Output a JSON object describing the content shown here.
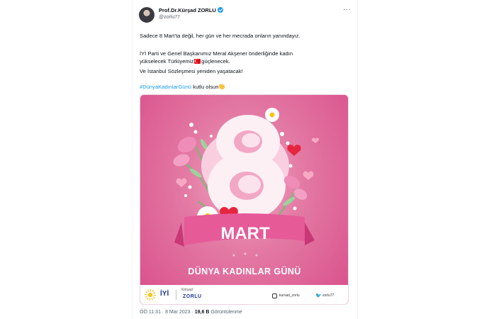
{
  "author": {
    "name": "Prof.Dr.Kürşad ZORLU",
    "handle": "@zorlu77"
  },
  "tweet": {
    "line1": "Sadece 8 Mart’ta değil, her gün ve her mecrada onların yanındayız.",
    "line2": "İYİ Parti ve Genel Başkanımız Meral Akşener önderliğinde kadın",
    "line3_pre": "yükselecek Türkiyemiz",
    "line3_post": "güçlenecek.",
    "line4": "Ve İstanbul Sözleşmesi yeniden yaşatacak!",
    "hashtag": "#DünyaKadınlarGünü",
    "line5_post": " kutlu olsun"
  },
  "media": {
    "number": "8",
    "banner_word": "MART",
    "subtitle": "DÜNYA KADINLAR GÜNÜ",
    "party_logo_text": "İYİ",
    "signature_text": "Kürşad",
    "signature_name": "ZORLU",
    "instagram_handle": "kursad_zorlu",
    "twitter_handle": "zorlu77"
  },
  "meta": {
    "time": "ÖÖ 11:31",
    "separator": "·",
    "date": "8 Mar 2023",
    "views": "19,6 B",
    "views_label": "Görüntülenme"
  },
  "colors": {
    "link": "#1d9bf0",
    "verified": "#1d9bf0",
    "banner_pink": "#e65a98"
  },
  "icons": [
    "verified-badge-icon",
    "more-options-icon",
    "turkey-flag-icon",
    "clapping-hands-icon",
    "instagram-icon",
    "twitter-bird-icon"
  ]
}
